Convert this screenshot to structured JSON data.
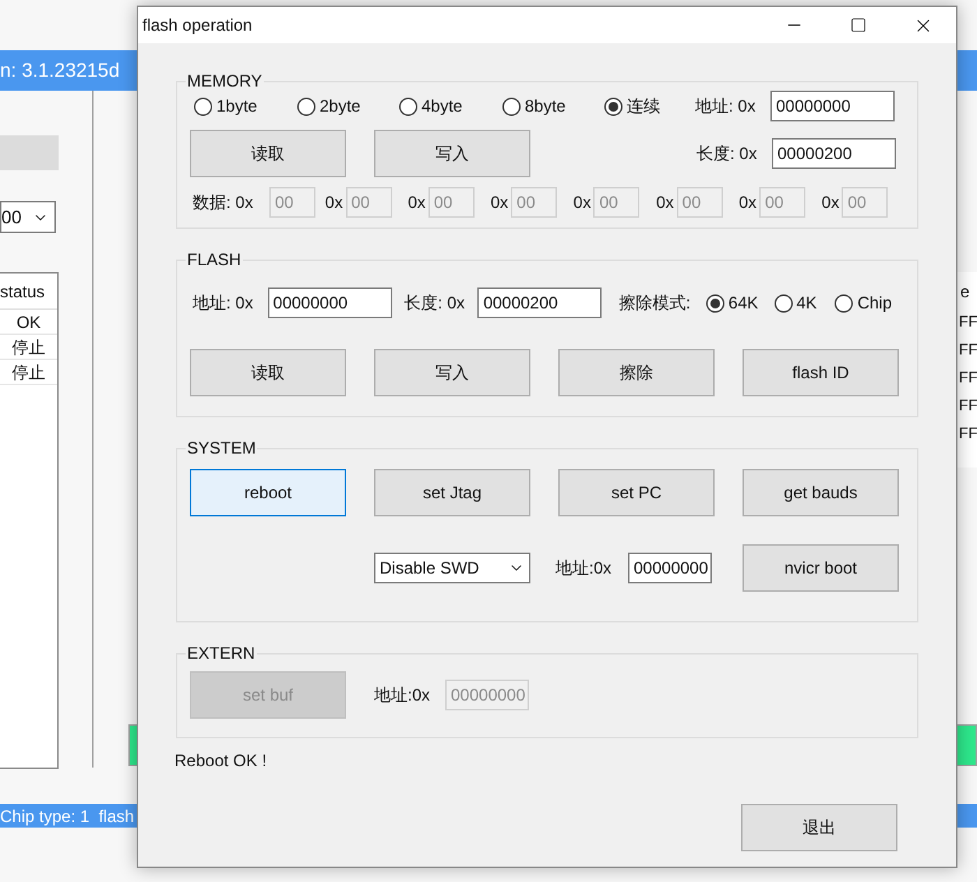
{
  "background_window": {
    "title": "n: 3.1.23215d",
    "combo_value": "00",
    "status_table": {
      "header": "status",
      "cells": [
        "OK",
        "停止",
        "停止"
      ]
    },
    "right_table": {
      "header": "e",
      "cells": [
        "FF",
        "FF",
        "FF",
        "FF",
        "FF"
      ]
    },
    "status_bar": "Chip type: 1  flash",
    "progress": {
      "level": 1
    }
  },
  "window": {
    "title": "flash operation"
  },
  "memory": {
    "title": "MEMORY",
    "modes": [
      {
        "label": "1byte",
        "selected": false
      },
      {
        "label": "2byte",
        "selected": false
      },
      {
        "label": "4byte",
        "selected": false
      },
      {
        "label": "8byte",
        "selected": false
      },
      {
        "label": "连续",
        "selected": true
      }
    ],
    "buttons": [
      "读取",
      "写入"
    ],
    "address": {
      "label": "地址: 0x",
      "value": "00000000"
    },
    "length": {
      "label": "长度: 0x",
      "value": "00000200"
    },
    "data": [
      {
        "label": "数据: 0x",
        "value": "00",
        "disabled": true
      },
      {
        "label": "0x",
        "value": "00",
        "disabled": true
      },
      {
        "label": "0x",
        "value": "00",
        "disabled": true
      },
      {
        "label": "0x",
        "value": "00",
        "disabled": true
      },
      {
        "label": "0x",
        "value": "00",
        "disabled": true
      },
      {
        "label": "0x",
        "value": "00",
        "disabled": true
      },
      {
        "label": "0x",
        "value": "00",
        "disabled": true
      },
      {
        "label": "0x",
        "value": "00",
        "disabled": true
      }
    ]
  },
  "flash": {
    "title": "FLASH",
    "address": {
      "label": "地址: 0x",
      "value": "00000000"
    },
    "length": {
      "label": "长度: 0x",
      "value": "00000200"
    },
    "erase_mode": {
      "label": "擦除模式:",
      "options": [
        {
          "label": "64K",
          "selected": true
        },
        {
          "label": "4K",
          "selected": false
        },
        {
          "label": "Chip",
          "selected": false
        }
      ]
    },
    "buttons": [
      "读取",
      "写入",
      "擦除",
      "flash ID"
    ]
  },
  "system": {
    "title": "SYSTEM",
    "buttons": [
      {
        "label": "reboot",
        "focused": true
      },
      {
        "label": "set Jtag",
        "focused": false
      },
      {
        "label": "set PC",
        "focused": false
      },
      {
        "label": "get bauds",
        "focused": false
      }
    ],
    "swd_select": "Disable SWD",
    "address": {
      "label": "地址:0x",
      "value": "00000000"
    },
    "boot_button": "nvicr boot"
  },
  "extern": {
    "title": "EXTERN",
    "button": {
      "label": "set buf",
      "disabled": true
    },
    "address": {
      "label": "地址:0x",
      "value": "00000000",
      "disabled": true
    }
  },
  "status_message": "Reboot OK !",
  "exit_button": "退出"
}
